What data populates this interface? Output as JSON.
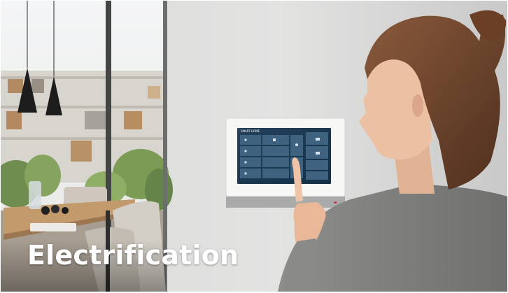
{
  "caption": {
    "title": "Electrification"
  },
  "panel": {
    "screen_title": "SMART HOME"
  }
}
